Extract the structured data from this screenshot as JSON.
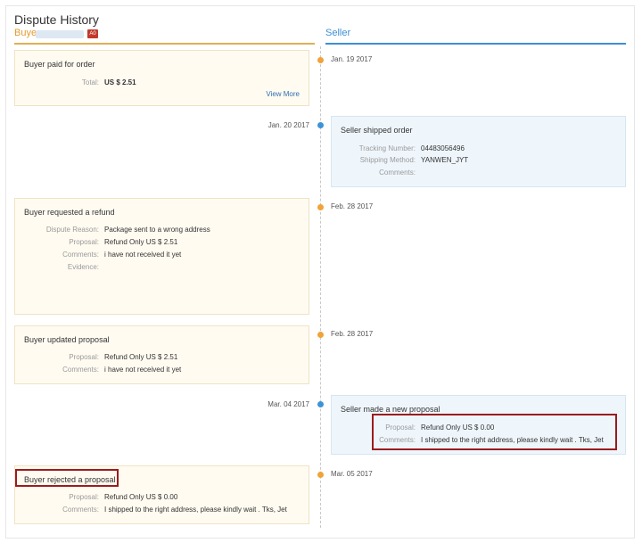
{
  "header": {
    "title": "Dispute History",
    "buyer_label": "Buyer",
    "buyer_badge": "A0",
    "seller_label": "Seller"
  },
  "events": [
    {
      "side": "buyer",
      "date": "Jan. 19 2017",
      "title": "Buyer paid for order",
      "fields": [
        {
          "label": "Total:",
          "value": "US $ 2.51"
        }
      ],
      "link": "View More"
    },
    {
      "side": "seller",
      "date": "Jan. 20 2017",
      "title": "Seller shipped order",
      "fields": [
        {
          "label": "Tracking Number:",
          "value": "04483056496"
        },
        {
          "label": "Shipping Method:",
          "value": "YANWEN_JYT"
        },
        {
          "label": "Comments:",
          "value": ""
        }
      ]
    },
    {
      "side": "buyer",
      "date": "Feb. 28 2017",
      "title": "Buyer requested a refund",
      "fields": [
        {
          "label": "Dispute Reason:",
          "value": "Package sent to a wrong address"
        },
        {
          "label": "Proposal:",
          "value": "Refund Only US $ 2.51"
        },
        {
          "label": "Comments:",
          "value": "i have not received it yet"
        },
        {
          "label": "Evidence:",
          "value": ""
        }
      ]
    },
    {
      "side": "buyer",
      "date": "Feb. 28 2017",
      "title": "Buyer updated proposal",
      "fields": [
        {
          "label": "Proposal:",
          "value": "Refund Only US $ 2.51"
        },
        {
          "label": "Comments:",
          "value": "i have not received it yet"
        }
      ]
    },
    {
      "side": "seller",
      "date": "Mar. 04 2017",
      "title": "Seller made a new proposal",
      "fields": [
        {
          "label": "Proposal:",
          "value": "Refund Only US $ 0.00"
        },
        {
          "label": "Comments:",
          "value": "I shipped to the right address, please kindly wait . Tks, Jet"
        }
      ]
    },
    {
      "side": "buyer",
      "date": "Mar. 05 2017",
      "title": "Buyer rejected a proposal",
      "fields": [
        {
          "label": "Proposal:",
          "value": "Refund Only US $ 0.00"
        },
        {
          "label": "Comments:",
          "value": "I shipped to the right address, please kindly wait . Tks, Jet"
        }
      ]
    }
  ]
}
